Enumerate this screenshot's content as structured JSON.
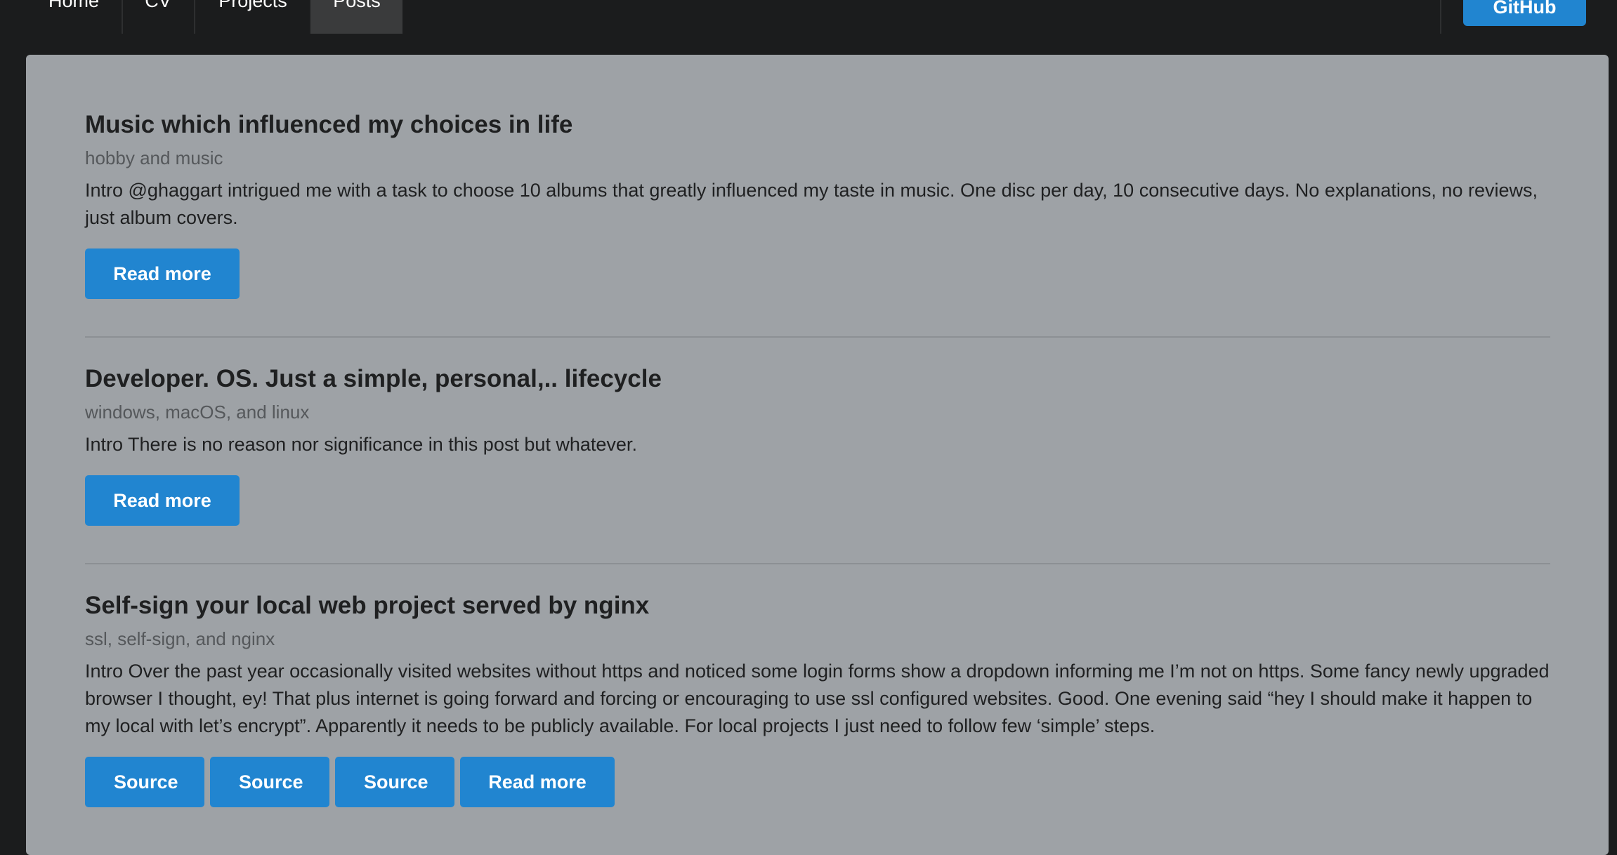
{
  "nav": {
    "items": [
      {
        "label": "Home"
      },
      {
        "label": "CV"
      },
      {
        "label": "Projects"
      },
      {
        "label": "Posts"
      }
    ],
    "active": "Posts",
    "github_label": "GitHub"
  },
  "posts": [
    {
      "title": "Music which influenced my choices in life",
      "tags": "hobby and music",
      "intro": "Intro @ghaggart intrigued me with a task to choose 10 albums that greatly influenced my taste in music. One disc per day, 10 consecutive days. No explanations, no reviews, just album covers.",
      "read_more": "Read more"
    },
    {
      "title": "Developer. OS. Just a simple, personal,.. lifecycle",
      "tags": "windows, macOS, and linux",
      "intro": "Intro There is no reason nor significance in this post but whatever.",
      "read_more": "Read more"
    },
    {
      "title": "Self-sign your local web project served by nginx",
      "tags": "ssl, self-sign, and nginx",
      "intro": "Intro Over the past year occasionally visited websites without https and noticed some login forms show a dropdown informing me I’m not on https. Some fancy newly upgraded browser I thought, ey! That plus internet is going forward and forcing or encouraging to use ssl configured websites. Good. One evening said “hey I should make it happen to my local with let’s encrypt”. Apparently it needs to be publicly available. For local projects I just need to follow few ‘simple’ steps.",
      "sources": [
        "Source",
        "Source",
        "Source"
      ],
      "read_more": "Read more"
    }
  ],
  "colors": {
    "topbar": "#1b1c1d",
    "panel": "#9ea2a6",
    "button": "#2185d0",
    "active_tab": "#3a3b3c"
  }
}
